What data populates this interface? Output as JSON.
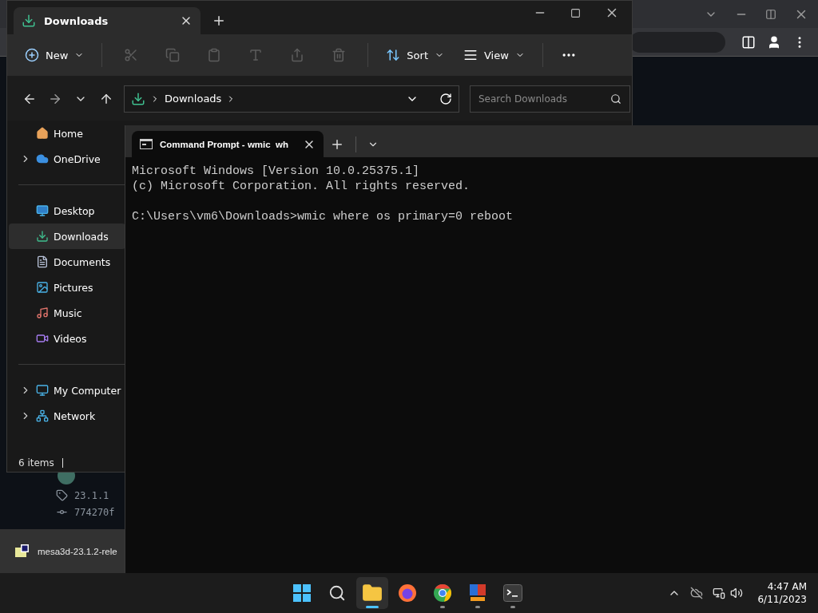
{
  "browser": {
    "tag": "23.1.1",
    "commit": "774270f",
    "download": {
      "filename": "mesa3d-23.1.2-rele"
    }
  },
  "explorer": {
    "tab": {
      "title": "Downloads",
      "selected": true
    },
    "new_button": {
      "label": "New"
    },
    "edit_actions": [
      {
        "disabled": true
      },
      {
        "disabled": true
      },
      {
        "disabled": true
      },
      {
        "disabled": true
      },
      {
        "disabled": true
      },
      {
        "disabled": true
      }
    ],
    "sort_button": {
      "label": "Sort"
    },
    "view_button": {
      "label": "View"
    },
    "address": {
      "crumb": "Downloads"
    },
    "search": {
      "placeholder": "Search Downloads"
    },
    "nav_groups": [
      {
        "items": [
          {
            "label": "Home",
            "expandable": false,
            "selected": false
          },
          {
            "label": "OneDrive",
            "expandable": true,
            "selected": false
          }
        ]
      },
      {
        "items": [
          {
            "label": "Desktop",
            "expandable": false,
            "selected": false
          },
          {
            "label": "Downloads",
            "expandable": false,
            "selected": true
          },
          {
            "label": "Documents",
            "expandable": false,
            "selected": false
          },
          {
            "label": "Pictures",
            "expandable": false,
            "selected": false
          },
          {
            "label": "Music",
            "expandable": false,
            "selected": false
          },
          {
            "label": "Videos",
            "expandable": false,
            "selected": false
          }
        ]
      },
      {
        "items": [
          {
            "label": "My Computer",
            "expandable": true,
            "selected": false
          },
          {
            "label": "Network",
            "expandable": true,
            "selected": false
          }
        ]
      }
    ],
    "status": "6 items"
  },
  "terminal": {
    "tab": {
      "title": "Command Prompt - wmic  wh",
      "selected": true
    },
    "output": [
      "Microsoft Windows [Version 10.0.25375.1]",
      "(c) Microsoft Corporation. All rights reserved."
    ],
    "prompt": "C:\\Users\\vm6\\Downloads>wmic where os primary=0 reboot"
  },
  "taskbar": {
    "apps": [
      {
        "running": true,
        "selected": true
      },
      {
        "running": false,
        "selected": false
      },
      {
        "running": true,
        "selected": false
      },
      {
        "running": true,
        "selected": false
      },
      {
        "running": true,
        "selected": false
      }
    ],
    "clock": {
      "time": "4:47 AM",
      "date": "6/11/2023"
    }
  }
}
